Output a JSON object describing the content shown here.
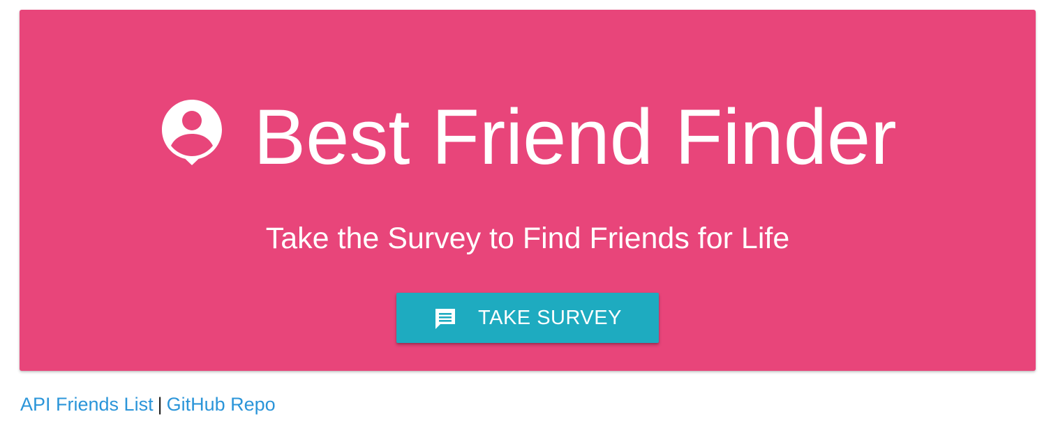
{
  "hero": {
    "title": "Best Friend Finder",
    "title_icon": "person-pin-icon",
    "subtitle": "Take the Survey to Find Friends for Life",
    "background_color": "#e8457a"
  },
  "survey_button": {
    "label": "TAKE SURVEY",
    "icon": "chat-bubble-icon",
    "background_color": "#1eabc0"
  },
  "footer": {
    "links": [
      {
        "label": "API Friends List"
      },
      {
        "label": "GitHub Repo"
      }
    ],
    "separator": "|",
    "link_color": "#2b95d9"
  }
}
